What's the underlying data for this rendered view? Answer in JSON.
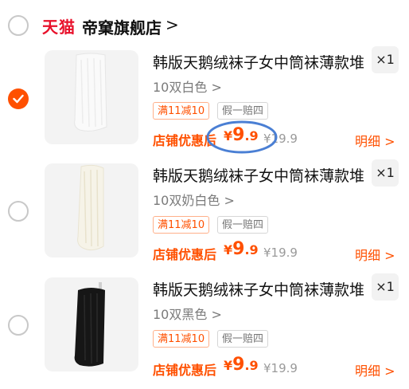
{
  "shop": {
    "brand": "天猫",
    "name": "帝窠旗舰店",
    "chevron": ">"
  },
  "items": [
    {
      "title": "韩版天鹅绒袜子女中筒袜薄款堆",
      "sku": "10双白色 >",
      "qty": "×1",
      "tags": [
        "满11减10",
        "假一赔四"
      ],
      "promo_label": "店铺优惠后",
      "price_symbol": "¥",
      "price_int": "9",
      "price_dec": ".9",
      "original_price": "¥19.9",
      "detail_label": "明细 >",
      "checked": true,
      "sock_color": "#f7f7f7"
    },
    {
      "title": "韩版天鹅绒袜子女中筒袜薄款堆",
      "sku": "10双奶白色 >",
      "qty": "×1",
      "tags": [
        "满11减10",
        "假一赔四"
      ],
      "promo_label": "店铺优惠后",
      "price_symbol": "¥",
      "price_int": "9",
      "price_dec": ".9",
      "original_price": "¥19.9",
      "detail_label": "明细 >",
      "checked": false,
      "sock_color": "#f5f2e6"
    },
    {
      "title": "韩版天鹅绒袜子女中筒袜薄款堆",
      "sku": "10双黑色 >",
      "qty": "×1",
      "tags": [
        "满11减10",
        "假一赔四"
      ],
      "promo_label": "店铺优惠后",
      "price_symbol": "¥",
      "price_int": "9",
      "price_dec": ".9",
      "original_price": "¥19.9",
      "detail_label": "明细 >",
      "checked": false,
      "sock_color": "#161616"
    }
  ],
  "colors": {
    "accent": "#ff5000",
    "brand": "#e8112b",
    "annotation": "#4a7fd4"
  }
}
